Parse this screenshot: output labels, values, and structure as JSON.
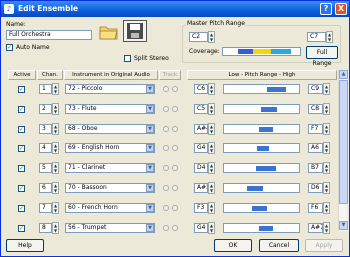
{
  "title": "Edit Ensemble",
  "help_glyph": "?",
  "close_glyph": "X",
  "app_glyph": "♪",
  "name": {
    "label": "Name:",
    "value": "Full Orchestra"
  },
  "auto_name": {
    "label": "Auto Name",
    "checked": true
  },
  "split_stereo": {
    "label": "Split Stereo",
    "checked": false
  },
  "master": {
    "title": "Master Pitch Range",
    "low": "C2",
    "high": "C7",
    "coverage_label": "Coverage:",
    "full_range_label": "Full Range"
  },
  "columns": {
    "active": "Active",
    "chan": "Chan.",
    "instrument": "Instrument in Original Audio",
    "track": "Track",
    "pitch": "Low - Pitch Range - High"
  },
  "rows": [
    {
      "chan": "1",
      "instrument": "72 - Piccolo",
      "low": "C6",
      "high": "C9",
      "range": [
        0.56,
        0.81
      ]
    },
    {
      "chan": "2",
      "instrument": "73 - Flute",
      "low": "C5",
      "high": "C8",
      "range": [
        0.48,
        0.69
      ]
    },
    {
      "chan": "3",
      "instrument": "68 - Oboe",
      "low": "A#4",
      "high": "F7",
      "range": [
        0.45,
        0.63
      ]
    },
    {
      "chan": "4",
      "instrument": "69 - English Horn",
      "low": "G4",
      "high": "A6",
      "range": [
        0.43,
        0.58
      ]
    },
    {
      "chan": "5",
      "instrument": "71 - Clarinet",
      "low": "D4",
      "high": "B7",
      "range": [
        0.41,
        0.67
      ]
    },
    {
      "chan": "6",
      "instrument": "70 - Bassoon",
      "low": "A#2",
      "high": "D6",
      "range": [
        0.3,
        0.51
      ]
    },
    {
      "chan": "7",
      "instrument": "60 - French Horn",
      "low": "F3",
      "high": "F6",
      "range": [
        0.36,
        0.55
      ]
    },
    {
      "chan": "8",
      "instrument": "56 - Trumpet",
      "low": "G4",
      "high": "A#7",
      "range": [
        0.46,
        0.64
      ]
    }
  ],
  "buttons": {
    "help": "Help",
    "ok": "OK",
    "cancel": "Cancel",
    "apply": "Apply"
  },
  "check_glyph": "✓",
  "spin_up": "▲",
  "spin_down": "▼",
  "dropdown_glyph": "▼",
  "colors": {
    "accent": "#0a5fdc",
    "range_bar": "#3a73d2",
    "coverage": [
      "#2f5de8",
      "#f4d800",
      "#2ba7e6"
    ]
  }
}
